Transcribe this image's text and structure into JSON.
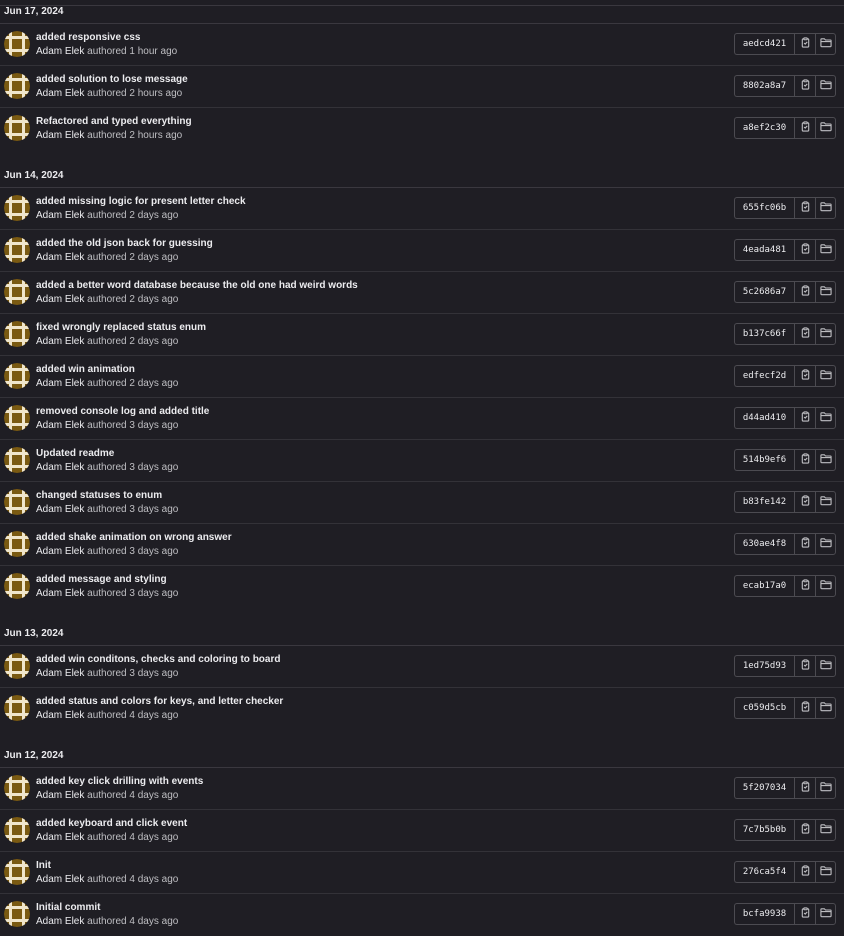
{
  "colors": {
    "background": "#1f1e24",
    "avatar_fill": "#7a5a12",
    "avatar_stripe": "#f0e6cc"
  },
  "icons": {
    "copy": "clipboard-icon",
    "browse": "folder-icon"
  },
  "authored_word": "authored",
  "groups": [
    {
      "date": "Jun 17, 2024",
      "commits": [
        {
          "title": "added responsive css",
          "author": "Adam Elek",
          "time": "1 hour ago",
          "sha": "aedcd421"
        },
        {
          "title": "added solution to lose message",
          "author": "Adam Elek",
          "time": "2 hours ago",
          "sha": "8802a8a7"
        },
        {
          "title": "Refactored and typed everything",
          "author": "Adam Elek",
          "time": "2 hours ago",
          "sha": "a8ef2c30"
        }
      ]
    },
    {
      "date": "Jun 14, 2024",
      "commits": [
        {
          "title": "added missing logic for present letter check",
          "author": "Adam Elek",
          "time": "2 days ago",
          "sha": "655fc06b"
        },
        {
          "title": "added the old json back for guessing",
          "author": "Adam Elek",
          "time": "2 days ago",
          "sha": "4eada481"
        },
        {
          "title": "added a better word database because the old one had weird words",
          "author": "Adam Elek",
          "time": "2 days ago",
          "sha": "5c2686a7"
        },
        {
          "title": "fixed wrongly replaced status enum",
          "author": "Adam Elek",
          "time": "2 days ago",
          "sha": "b137c66f"
        },
        {
          "title": "added win animation",
          "author": "Adam Elek",
          "time": "2 days ago",
          "sha": "edfecf2d"
        },
        {
          "title": "removed console log and added title",
          "author": "Adam Elek",
          "time": "3 days ago",
          "sha": "d44ad410"
        },
        {
          "title": "Updated readme",
          "author": "Adam Elek",
          "time": "3 days ago",
          "sha": "514b9ef6"
        },
        {
          "title": "changed statuses to enum",
          "author": "Adam Elek",
          "time": "3 days ago",
          "sha": "b83fe142"
        },
        {
          "title": "added shake animation on wrong answer",
          "author": "Adam Elek",
          "time": "3 days ago",
          "sha": "630ae4f8"
        },
        {
          "title": "added message and styling",
          "author": "Adam Elek",
          "time": "3 days ago",
          "sha": "ecab17a0"
        }
      ]
    },
    {
      "date": "Jun 13, 2024",
      "commits": [
        {
          "title": "added win conditons, checks and coloring to board",
          "author": "Adam Elek",
          "time": "3 days ago",
          "sha": "1ed75d93"
        },
        {
          "title": "added status and colors for keys, and letter checker",
          "author": "Adam Elek",
          "time": "4 days ago",
          "sha": "c059d5cb"
        }
      ]
    },
    {
      "date": "Jun 12, 2024",
      "commits": [
        {
          "title": "added key click drilling with events",
          "author": "Adam Elek",
          "time": "4 days ago",
          "sha": "5f207034"
        },
        {
          "title": "added keyboard and click event",
          "author": "Adam Elek",
          "time": "4 days ago",
          "sha": "7c7b5b0b"
        },
        {
          "title": "Init",
          "author": "Adam Elek",
          "time": "4 days ago",
          "sha": "276ca5f4"
        },
        {
          "title": "Initial commit",
          "author": "Adam Elek",
          "time": "4 days ago",
          "sha": "bcfa9938"
        }
      ]
    }
  ]
}
